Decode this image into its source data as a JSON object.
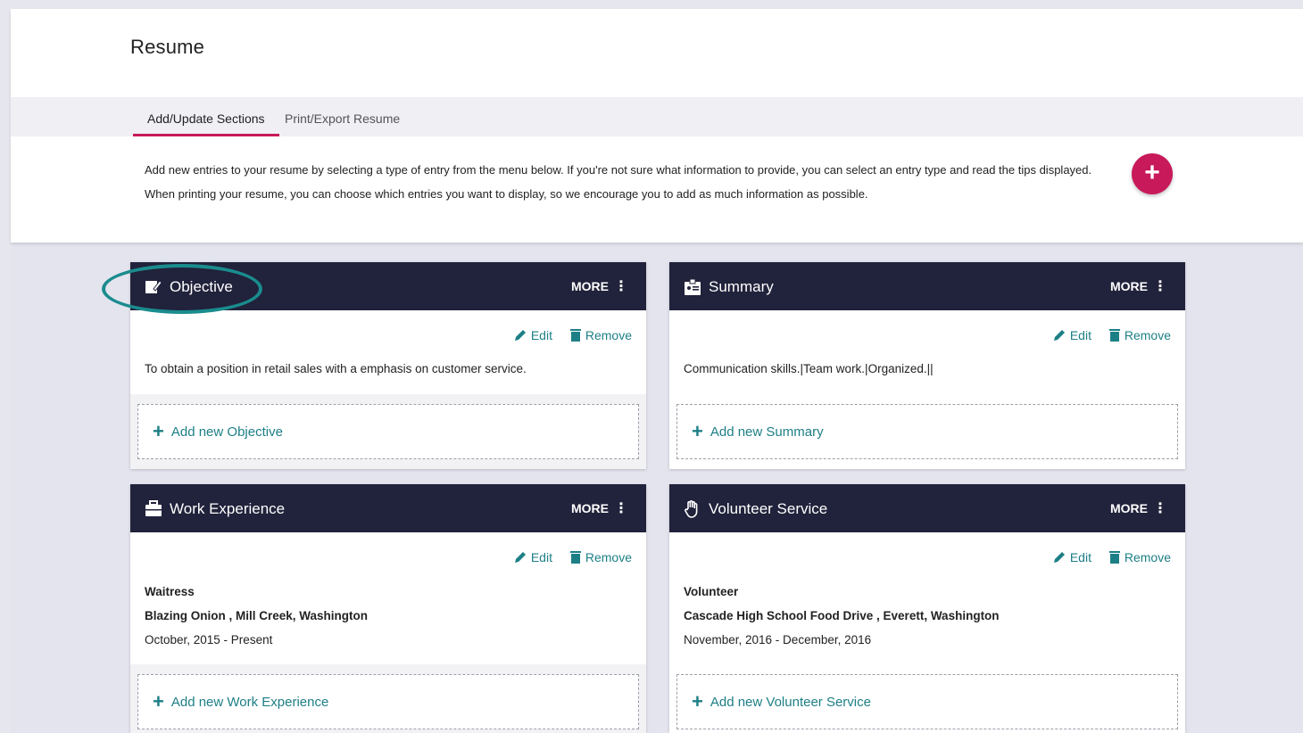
{
  "page": {
    "title": "Resume"
  },
  "tabs": [
    {
      "label": "Add/Update Sections",
      "active": true
    },
    {
      "label": "Print/Export Resume",
      "active": false
    }
  ],
  "intro": {
    "line1": "Add new entries to your resume by selecting a type of entry from the menu below. If you're not sure what information to provide, you can select an entry type and read the tips displayed.",
    "line2": "When printing your resume, you can choose which entries you want to display, so we encourage you to add as much information as possible."
  },
  "fab": {
    "label": "+"
  },
  "colors": {
    "accent": "#c8195a",
    "header_dark": "#21223b",
    "teal": "#1d7f86"
  },
  "common": {
    "more": "MORE",
    "edit": "Edit",
    "remove": "Remove"
  },
  "cards": {
    "objective": {
      "title": "Objective",
      "icon": "edit-note-icon",
      "text": "To obtain a position in retail sales with a emphasis on customer service.",
      "add": "Add new Objective"
    },
    "summary": {
      "title": "Summary",
      "icon": "id-badge-icon",
      "text": "Communication skills.|Team work.|Organized.||",
      "add": "Add new Summary"
    },
    "work": {
      "title": "Work Experience",
      "icon": "briefcase-icon",
      "role": "Waitress",
      "org": "Blazing Onion , Mill Creek, Washington",
      "dates": "October, 2015 - Present",
      "add": "Add new Work Experience"
    },
    "volunteer": {
      "title": "Volunteer Service",
      "icon": "hand-icon",
      "role": "Volunteer",
      "org": "Cascade High School Food Drive , Everett, Washington",
      "dates": "November, 2016 - December, 2016",
      "add": "Add new Volunteer Service"
    }
  }
}
